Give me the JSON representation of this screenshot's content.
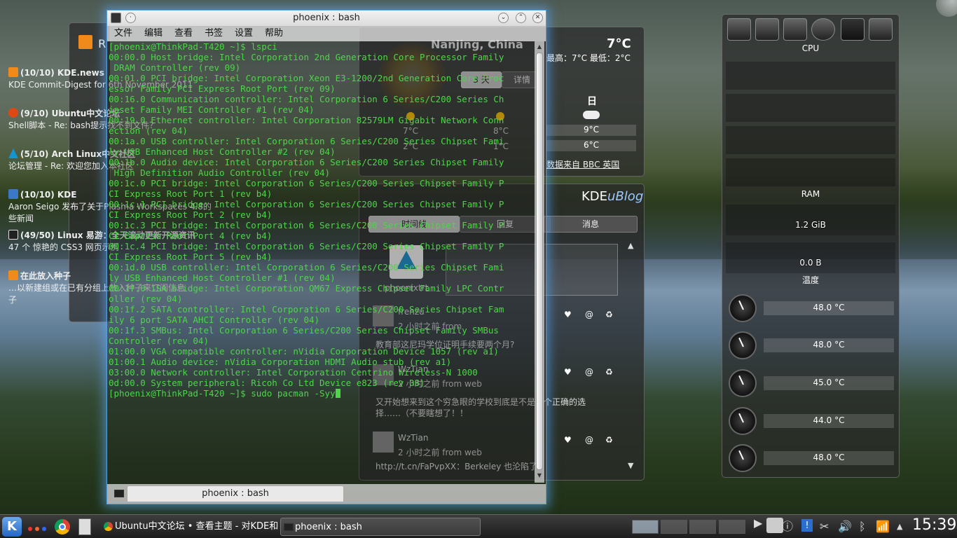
{
  "rss": {
    "title_partial": "R",
    "items": [
      {
        "head": "(10/10) KDE.news",
        "text": "KDE Commit-Digest for 6th November 2011"
      },
      {
        "head": "(9/10) Ubuntu中文论坛",
        "text": "Shell脚本 - Re: bash提示找不到文件？"
      },
      {
        "head": "(5/10) Arch Linux中文社区",
        "text": "论坛管理 - Re: 欢迎您加入本社区"
      },
      {
        "head": "(10/10) KDE",
        "text": "Aaron Seigo 发布了关于Plasma Workspaces 4.8的",
        "text2": "些新闻"
      },
      {
        "head": "(49/50) Linux 易游：全天滚动更新开源资讯",
        "text": "47 个 惊艳的 CSS3 网页示例"
      },
      {
        "head": "在此放入种子",
        "text": "…以新建组或在已有分组上放入种子来订阅信息",
        "text2": "子"
      }
    ]
  },
  "weather": {
    "location": "Nanjing, China",
    "temp": "7°C",
    "minmax": "最高：7°C 最低：2°C",
    "tab_days": "3 天",
    "tab_details": "详情",
    "day_header": "日",
    "high_low": [
      [
        "7°C",
        "8°C",
        "9°C"
      ],
      [
        "2°C",
        "1°C",
        "6°C"
      ]
    ],
    "source": "数据来自 BBC 英国"
  },
  "blog": {
    "logo_kde": "KDE",
    "logo_blog": "uBlog",
    "tabs": {
      "timeline": "时间线",
      "replies": "回复",
      "messages": "消息"
    },
    "user": "phoenixtrt",
    "posts": [
      {
        "name": "frenzu",
        "time": "2 小时之前 from",
        "text": "教育部这尼玛学位证明手续要两个月?"
      },
      {
        "name": "WzTian",
        "time": "2 小时之前 from web",
        "text": "又开始想来到这个穷急眼的学校到底是不是一个正确的选择……（不要瞎想了！！"
      },
      {
        "name": "WzTian",
        "time": "2 小时之前 from web",
        "text": "http://t.cn/FaPvpXX：Berkeley 也沦陷了"
      }
    ]
  },
  "sysmon": {
    "cpu": "CPU",
    "ram": "RAM",
    "ram_vals": [
      "1.2 GiB",
      "0.0 B"
    ],
    "temp": "温度",
    "temps": [
      "48.0 °C",
      "48.0 °C",
      "45.0 °C",
      "44.0 °C",
      "48.0 °C"
    ]
  },
  "konsole": {
    "title": "phoenix : bash",
    "menu": [
      "文件",
      "编辑",
      "查看",
      "书签",
      "设置",
      "帮助"
    ],
    "lines": [
      "[phoenix@ThinkPad-T420 ~]$ lspci",
      "00:00.0 Host bridge: Intel Corporation 2nd Generation Core Processor Family",
      " DRAM Controller (rev 09)",
      "00:01.0 PCI bridge: Intel Corporation Xeon E3-1200/2nd Generation Core Proc",
      "essor Family PCI Express Root Port (rev 09)",
      "00:16.0 Communication controller: Intel Corporation 6 Series/C200 Series Ch",
      "ipset Family MEI Controller #1 (rev 04)",
      "00:19.0 Ethernet controller: Intel Corporation 82579LM Gigabit Network Conn",
      "ection (rev 04)",
      "00:1a.0 USB controller: Intel Corporation 6 Series/C200 Series Chipset Fami",
      "ly USB Enhanced Host Controller #2 (rev 04)",
      "00:1b.0 Audio device: Intel Corporation 6 Series/C200 Series Chipset Family",
      " High Definition Audio Controller (rev 04)",
      "00:1c.0 PCI bridge: Intel Corporation 6 Series/C200 Series Chipset Family P",
      "CI Express Root Port 1 (rev b4)",
      "00:1c.1 PCI bridge: Intel Corporation 6 Series/C200 Series Chipset Family P",
      "CI Express Root Port 2 (rev b4)",
      "00:1c.3 PCI bridge: Intel Corporation 6 Series/C200 Series Chipset Family P",
      "CI Express Root Port 4 (rev b4)",
      "00:1c.4 PCI bridge: Intel Corporation 6 Series/C200 Series Chipset Family P",
      "CI Express Root Port 5 (rev b4)",
      "00:1d.0 USB controller: Intel Corporation 6 Series/C200 Series Chipset Fami",
      "ly USB Enhanced Host Controller #1 (rev 04)",
      "00:1f.0 ISA bridge: Intel Corporation QM67 Express Chipset Family LPC Contr",
      "oller (rev 04)",
      "00:1f.2 SATA controller: Intel Corporation 6 Series/C200 Series Chipset Fam",
      "ily 6 port SATA AHCI Controller (rev 04)",
      "00:1f.3 SMBus: Intel Corporation 6 Series/C200 Series Chipset Family SMBus",
      "Controller (rev 04)",
      "01:00.0 VGA compatible controller: nVidia Corporation Device 1057 (rev a1)",
      "01:00.1 Audio device: nVidia Corporation HDMI Audio stub (rev a1)",
      "03:00.0 Network controller: Intel Corporation Centrino Wireless-N 1000",
      "0d:00.0 System peripheral: Ricoh Co Ltd Device e823 (rev 08)"
    ],
    "prompt": "[phoenix@ThinkPad-T420 ~]$ sudo pacman -Syy",
    "tab": "phoenix : bash"
  },
  "taskbar": {
    "task1": "Ubuntu中文论坛 • 查看主题 - 对KDE和gn",
    "task2": "phoenix : bash",
    "clock": "15:39"
  },
  "colors": {
    "terminal_text": "#4cd648",
    "window_glow": "#5aa0d8",
    "rss_orange": "#f08a1a"
  }
}
